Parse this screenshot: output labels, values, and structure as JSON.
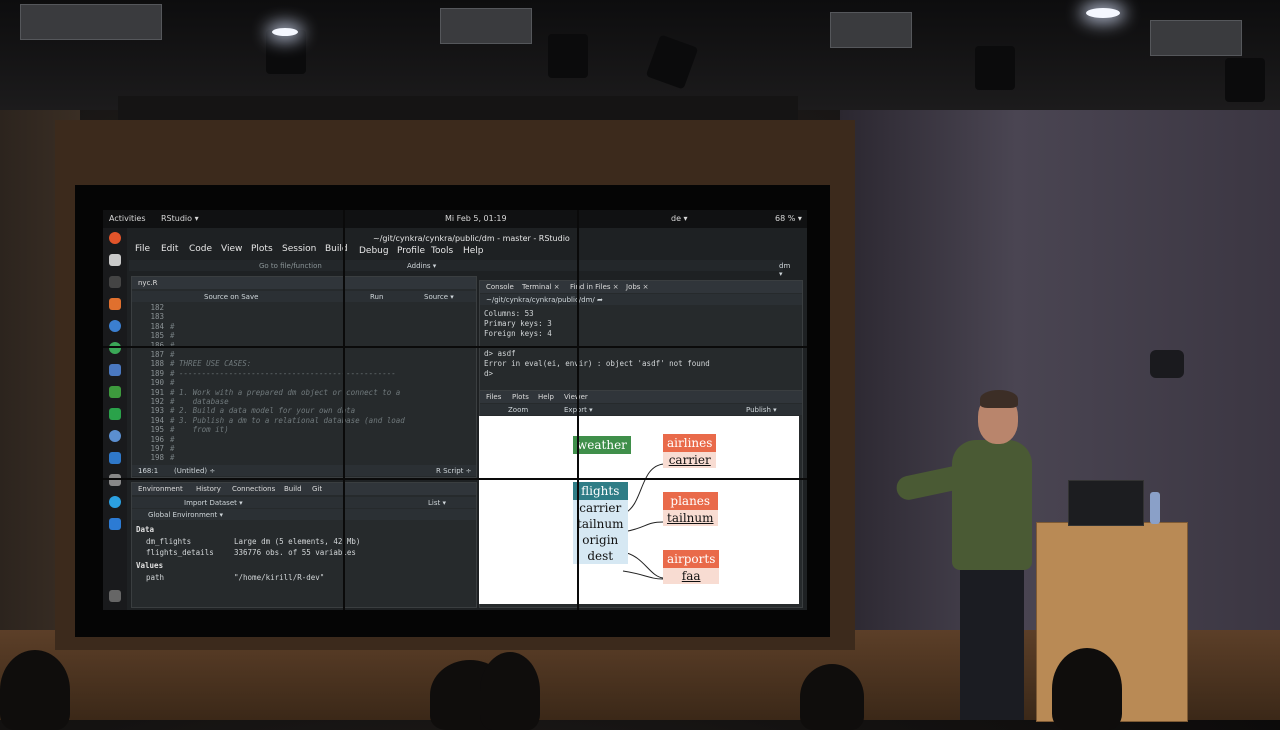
{
  "room": {
    "light_color": "#f4f7ff",
    "wood_color": "#5c3f28"
  },
  "screen": {
    "topbar": {
      "activities": "Activities",
      "app": "RStudio ▾",
      "clock": "Mi Feb 5, 01:19",
      "lang": "de ▾",
      "battery": "68 % ▾"
    },
    "window_title": "~/git/cynkra/cynkra/public/dm - master - RStudio",
    "menu": [
      "File",
      "Edit",
      "Code",
      "View",
      "Plots",
      "Session",
      "Build",
      "Debug",
      "Profile",
      "Tools",
      "Help"
    ],
    "toolbar": {
      "goto": "Go to file/function",
      "addins": "Addins ▾",
      "project": "dm ▾"
    },
    "editor": {
      "tab": "nyc.R",
      "source_on_save": "Source on Save",
      "run": "Run",
      "source": "Source ▾",
      "status_pos": "168:1",
      "status_scope": "(Untitled) ÷",
      "status_type": "R Script ÷",
      "lines": [
        {
          "n": "182",
          "t": ""
        },
        {
          "n": "183",
          "t": ""
        },
        {
          "n": "184",
          "t": "#"
        },
        {
          "n": "185",
          "t": "#"
        },
        {
          "n": "186",
          "t": "#"
        },
        {
          "n": "187",
          "t": "#"
        },
        {
          "n": "188",
          "t": "# THREE USE CASES:"
        },
        {
          "n": "189",
          "t": "# ------------------------------------------------"
        },
        {
          "n": "190",
          "t": "#"
        },
        {
          "n": "191",
          "t": "# 1. Work with a prepared dm object or connect to a"
        },
        {
          "n": "192",
          "t": "#    database"
        },
        {
          "n": "193",
          "t": "# 2. Build a data model for your own data"
        },
        {
          "n": "194",
          "t": "# 3. Publish a dm to a relational database (and load"
        },
        {
          "n": "195",
          "t": "#    from it)"
        },
        {
          "n": "196",
          "t": "#"
        },
        {
          "n": "197",
          "t": "#"
        },
        {
          "n": "198",
          "t": "#"
        }
      ]
    },
    "environment": {
      "tabs": [
        "Environment",
        "History",
        "Connections",
        "Build",
        "Git"
      ],
      "import": "Import Dataset ▾",
      "list": "List ▾",
      "scope": "Global Environment ▾",
      "data_header": "Data",
      "values_header": "Values",
      "rows": [
        {
          "name": "dm_flights",
          "value": "Large dm (5 elements, 42 Mb)"
        },
        {
          "name": "flights_details",
          "value": "336776 obs. of 55 variables"
        }
      ],
      "values": [
        {
          "name": "path",
          "value": "\"/home/kirill/R-dev\""
        }
      ]
    },
    "console": {
      "tabs": [
        "Console",
        "Terminal ×",
        "Find in Files ×",
        "Jobs ×"
      ],
      "path": "~/git/cynkra/cynkra/public/dm/ ➦",
      "lines": [
        "Columns: 53",
        "Primary keys: 3",
        "Foreign keys: 4",
        "",
        "d> asdf",
        "Error in eval(ei, envir) : object 'asdf' not found",
        "d>"
      ]
    },
    "viewer": {
      "tabs": [
        "Files",
        "Plots",
        "Help",
        "Viewer"
      ],
      "zoom": "Zoom",
      "export": "Export ▾",
      "publish": "Publish ▾",
      "tables": {
        "weather": {
          "name": "weather",
          "color": "#3f8f4a"
        },
        "flights": {
          "name": "flights",
          "color": "#2f7d86",
          "cols": [
            "carrier",
            "tailnum",
            "origin",
            "dest"
          ]
        },
        "airlines": {
          "name": "airlines",
          "color": "#e96a4a",
          "cols": [
            "carrier"
          ]
        },
        "planes": {
          "name": "planes",
          "color": "#e96a4a",
          "cols": [
            "tailnum"
          ]
        },
        "airports": {
          "name": "airports",
          "color": "#e96a4a",
          "cols": [
            "faa"
          ]
        }
      }
    }
  }
}
